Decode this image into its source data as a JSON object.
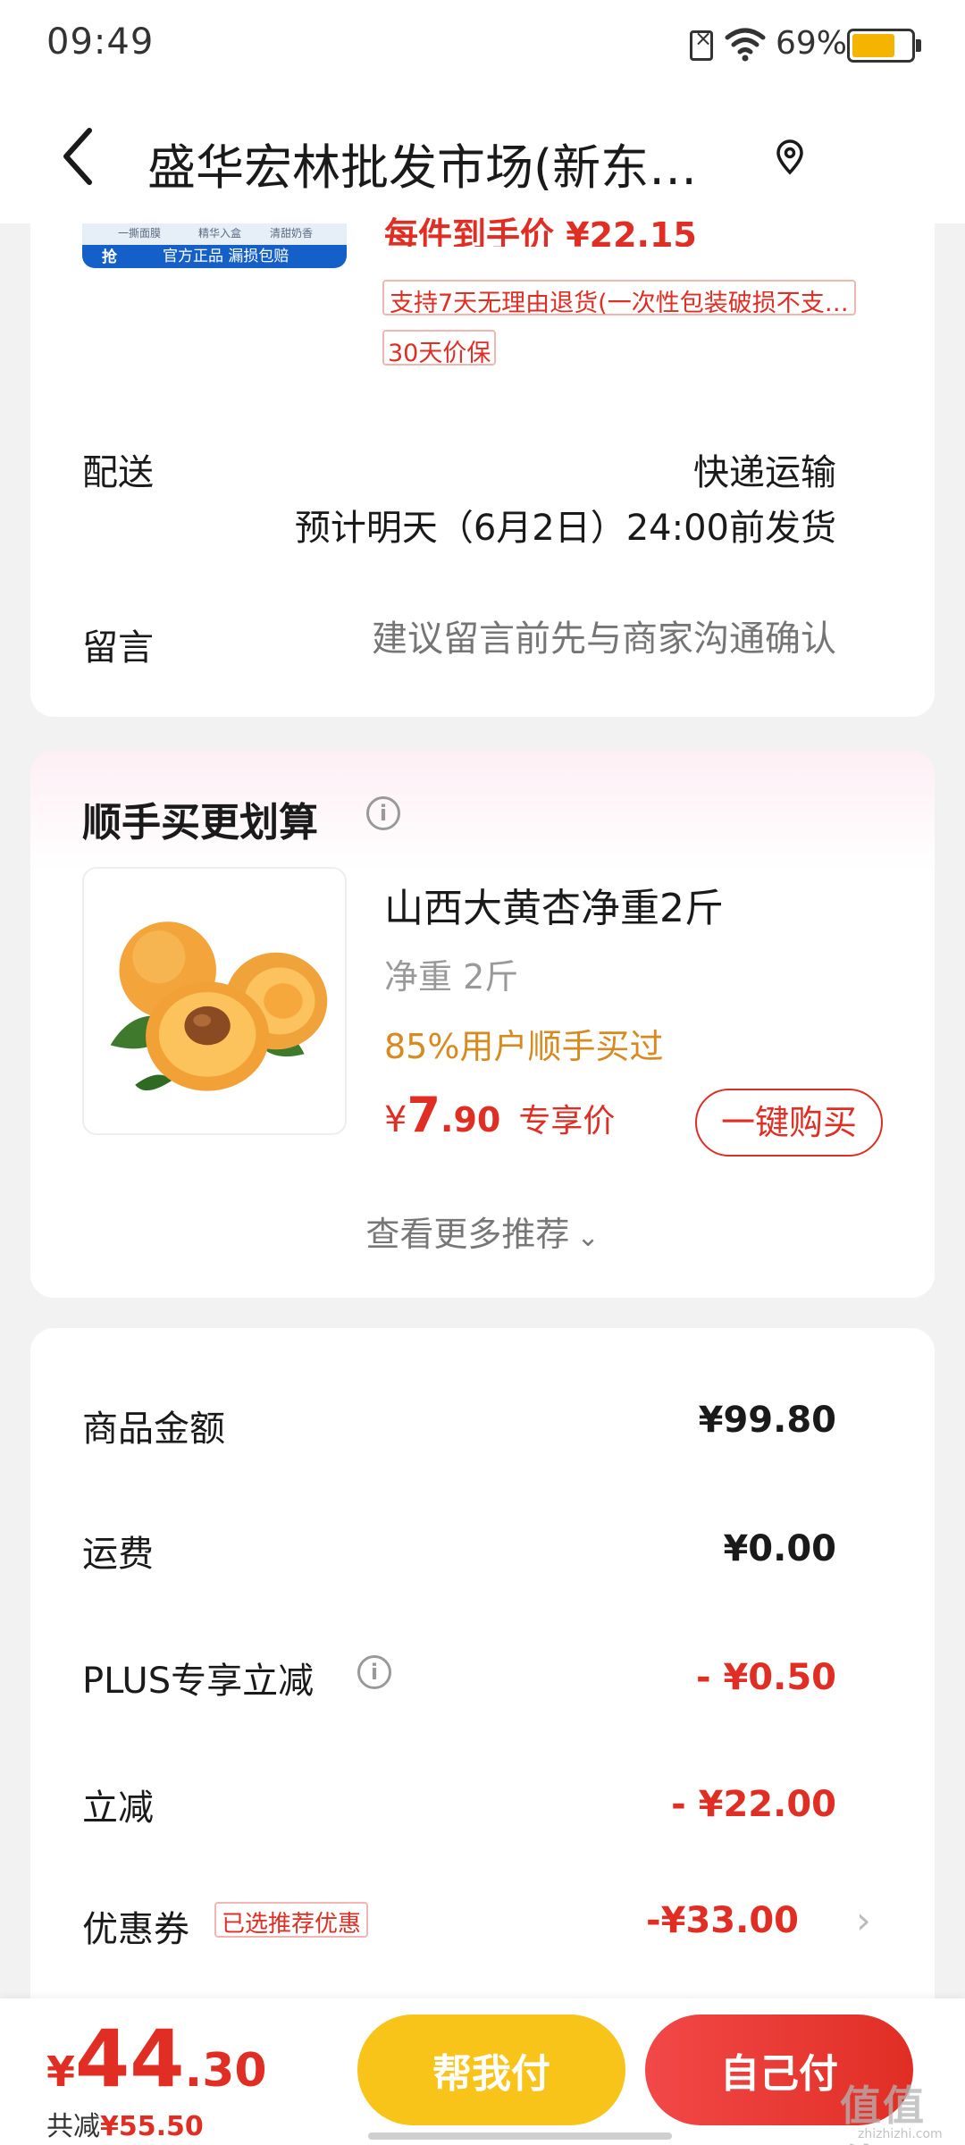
{
  "status_bar": {
    "time": "09:49",
    "battery": "69%"
  },
  "header": {
    "title": "盛华宏林批发市场(新东…"
  },
  "order_item": {
    "price_line": "每件到手价 ¥22.15",
    "thumb_badge": "抢",
    "thumb_band": "官方正品 漏损包赔",
    "thumb_tiny": [
      "一撕面膜",
      "精华入盒",
      "清甜奶香"
    ],
    "tags": [
      "支持7天无理由退货(一次性包装破损不支…",
      "30天价保"
    ]
  },
  "delivery": {
    "label": "配送",
    "method": "快递运输",
    "eta": "预计明天（6月2日）24:00前发货"
  },
  "message": {
    "label": "留言",
    "placeholder": "建议留言前先与商家沟通确认"
  },
  "bundle": {
    "title": "顺手买更划算",
    "info_icon": "i",
    "product": {
      "name": "山西大黄杏净重2斤",
      "spec": "净重 2斤",
      "popularity": "85%用户顺手买过",
      "price_symbol": "¥",
      "price_int": "7",
      "price_dec": ".90",
      "price_tag": "专享价",
      "buy_label": "一键购买"
    },
    "more_label": "查看更多推荐"
  },
  "summary": {
    "rows": [
      {
        "label": "商品金额",
        "value": "¥99.80"
      },
      {
        "label": "运费",
        "value": "¥0.00"
      },
      {
        "label": "PLUS专享立减",
        "value": "- ¥0.50"
      },
      {
        "label": "立减",
        "value": "- ¥22.00"
      },
      {
        "label": "优惠券",
        "value": "-¥33.00",
        "badge": "已选推荐优惠"
      }
    ]
  },
  "footer": {
    "price_symbol": "¥",
    "price_int": "44",
    "price_dec": ".30",
    "saved_label": "共减",
    "saved_amount": "¥55.50",
    "pay_friend_label": "帮我付",
    "pay_self_label": "自己付",
    "watermark": "值值值",
    "watermark_sub": "zhizhizhi.com"
  },
  "colors": {
    "accent_red": "#e02e24",
    "friend_yellow": "#f8c41a",
    "popularity_orange": "#d68a1f"
  }
}
